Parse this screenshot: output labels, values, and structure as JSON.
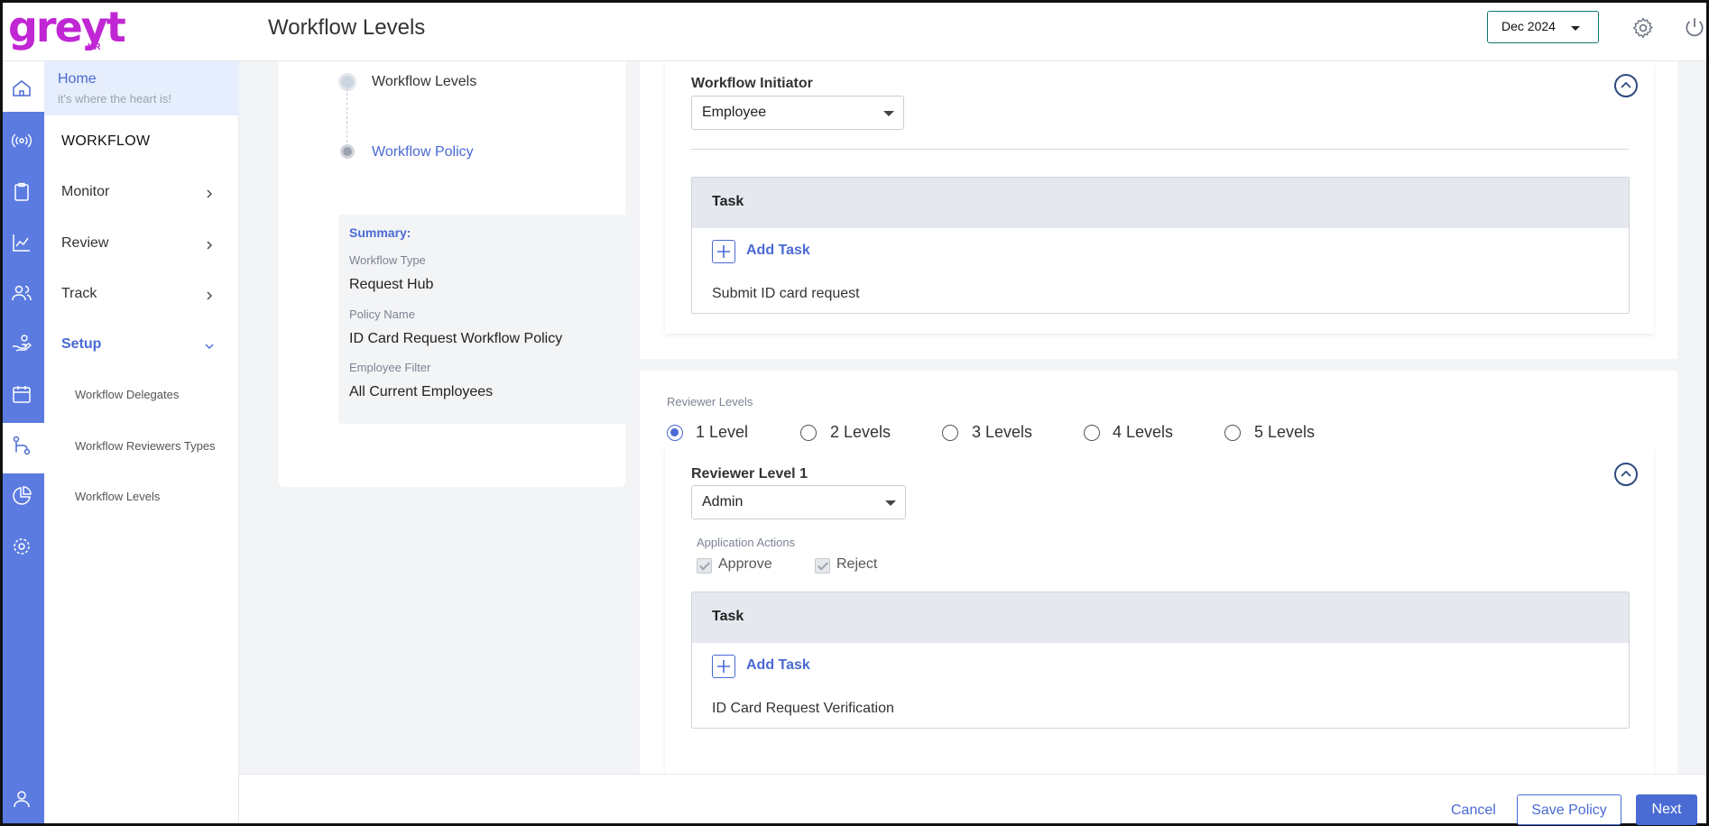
{
  "app": {
    "logo_text": "greyt",
    "logo_sub": "HR",
    "page_title": "Workflow Levels",
    "period": "Dec 2024"
  },
  "nav": {
    "home_title": "Home",
    "home_subtitle": "it's where the heart is!",
    "section_title": "WORKFLOW",
    "items": [
      {
        "label": "Monitor"
      },
      {
        "label": "Review"
      },
      {
        "label": "Track"
      },
      {
        "label": "Setup"
      }
    ],
    "subitems": [
      {
        "label": "Workflow Delegates"
      },
      {
        "label": "Workflow Reviewers Types"
      },
      {
        "label": "Workflow Levels"
      }
    ]
  },
  "stepper": {
    "steps": [
      {
        "label": "Workflow Levels"
      },
      {
        "label": "Workflow Policy"
      }
    ]
  },
  "summary": {
    "heading": "Summary:",
    "workflow_type_label": "Workflow Type",
    "workflow_type_value": "Request Hub",
    "policy_name_label": "Policy Name",
    "policy_name_value": "ID Card Request Workflow Policy",
    "employee_filter_label": "Employee Filter",
    "employee_filter_value": "All Current Employees"
  },
  "initiator": {
    "label": "Workflow Initiator",
    "selected": "Employee",
    "task_header": "Task",
    "add_task_label": "Add Task",
    "tasks": [
      "Submit ID card request"
    ]
  },
  "reviewer_levels": {
    "label": "Reviewer Levels",
    "options": [
      "1 Level",
      "2 Levels",
      "3 Levels",
      "4 Levels",
      "5 Levels"
    ],
    "selected_index": 0
  },
  "reviewer_level_1": {
    "label": "Reviewer Level 1",
    "selected": "Admin",
    "actions_label": "Application Actions",
    "actions": [
      {
        "label": "Approve",
        "checked": true
      },
      {
        "label": "Reject",
        "checked": true
      }
    ],
    "task_header": "Task",
    "add_task_label": "Add Task",
    "tasks": [
      "ID Card Request Verification"
    ]
  },
  "footer": {
    "cancel_label": "Cancel",
    "save_label": "Save Policy",
    "next_label": "Next"
  },
  "colors": {
    "brand": "#c026d3",
    "accent": "#4a6ad4",
    "rail": "#5b7be0"
  }
}
